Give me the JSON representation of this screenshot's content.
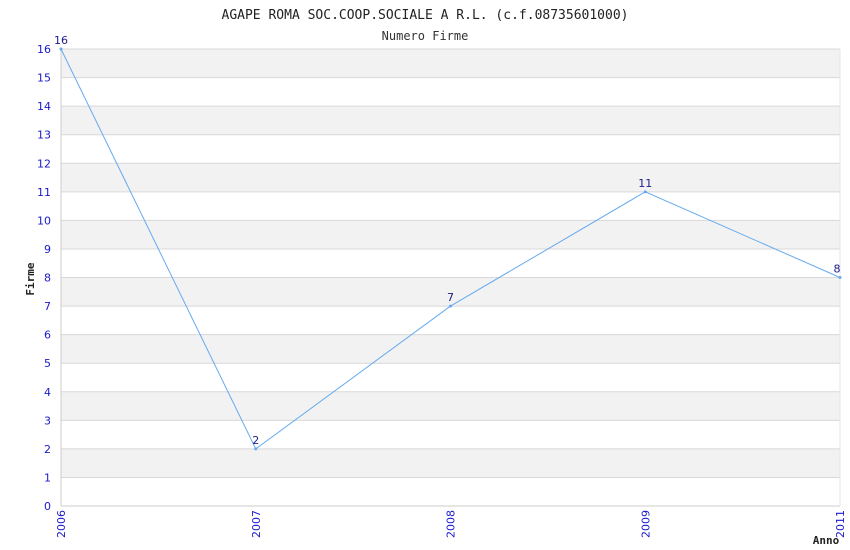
{
  "chart_data": {
    "type": "line",
    "title": "AGAPE ROMA SOC.COOP.SOCIALE A R.L. (c.f.08735601000)",
    "subtitle": "Numero Firme",
    "xlabel": "Anno",
    "ylabel": "Firme",
    "x": [
      "2006",
      "2007",
      "2008",
      "2009",
      "2011"
    ],
    "values": [
      16,
      2,
      7,
      11,
      8
    ],
    "ylim": [
      0,
      16
    ],
    "yticks": [
      0,
      1,
      2,
      3,
      4,
      5,
      6,
      7,
      8,
      9,
      10,
      11,
      12,
      13,
      14,
      15,
      16
    ],
    "grid": true,
    "colors": {
      "line": "#66aaee",
      "band": "#f2f2f2",
      "gridline": "#d8d8d8",
      "tick_text": "#1a1acc",
      "label_text": "#1a1a8a"
    }
  }
}
